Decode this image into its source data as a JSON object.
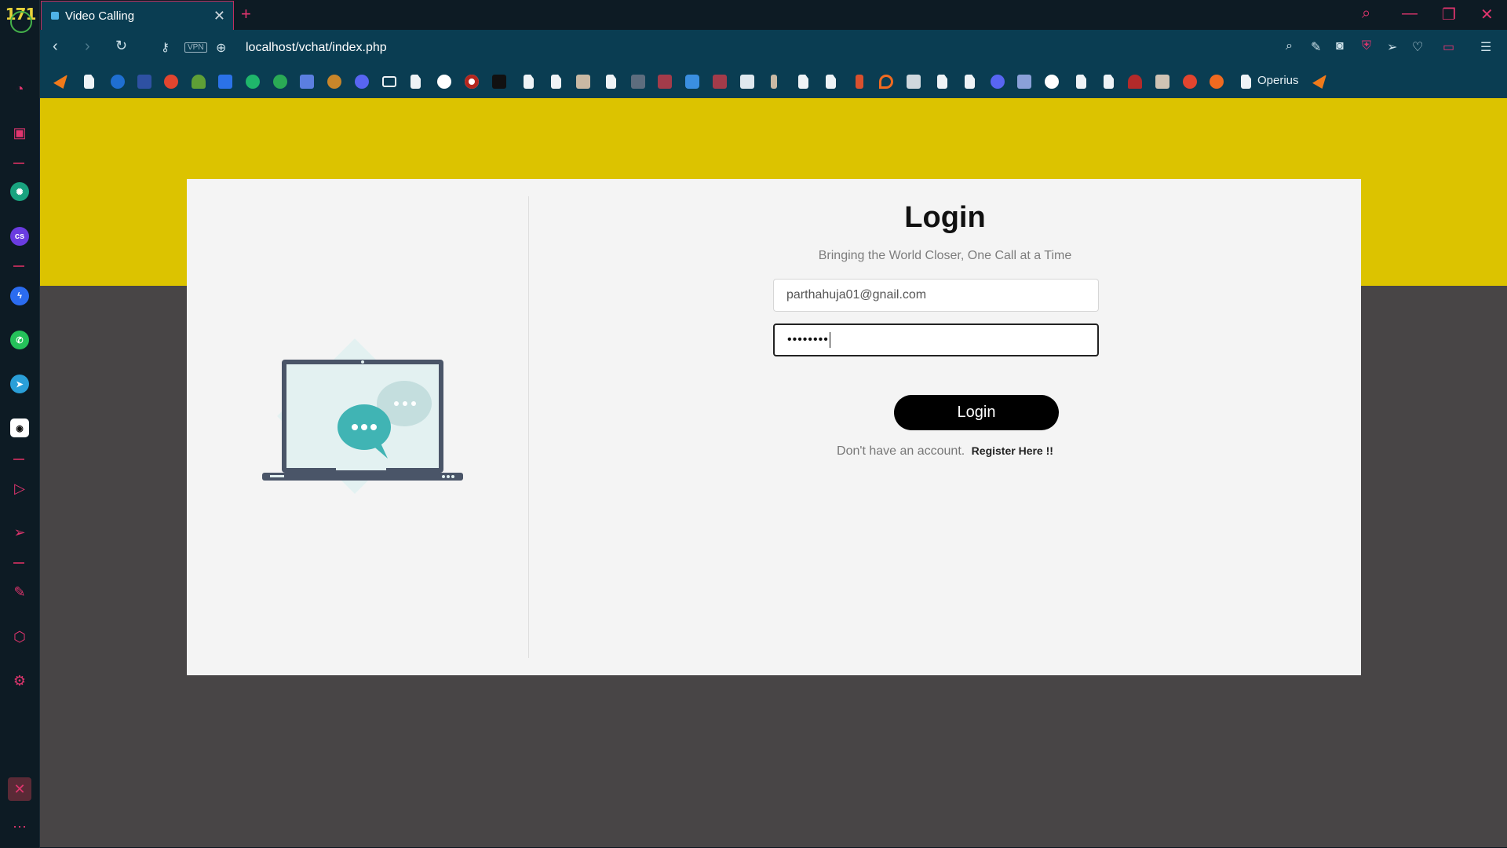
{
  "browser": {
    "tab_title": "Video Calling",
    "tab_close": "✕",
    "new_tab": "+",
    "url": "localhost/vchat/index.php",
    "vpn": "VPN",
    "bookmark_label": "Operius",
    "logo": "171"
  },
  "login": {
    "title": "Login",
    "tagline": "Bringing the World Closer, One Call at a Time",
    "email_value": "parthahuja01@gnail.com",
    "password_mask": "••••••••",
    "button_label": "Login",
    "register_prompt": "Don't have an account.",
    "register_link": "Register Here !!"
  },
  "colors": {
    "header_yellow": "#dcc300",
    "page_gray": "#484546",
    "card_bg": "#f4f4f4",
    "accent": "#e0356e",
    "chat_teal": "#40b4b4"
  },
  "icons": {
    "sidebar": [
      "speed-dial-icon",
      "bag-icon",
      "chatgpt-icon",
      "cs-icon",
      "messenger-icon",
      "whatsapp-icon",
      "telegram-icon",
      "discord-icon",
      "player-icon",
      "send-icon",
      "notes-icon",
      "box-icon",
      "settings-icon",
      "more-icon"
    ]
  }
}
